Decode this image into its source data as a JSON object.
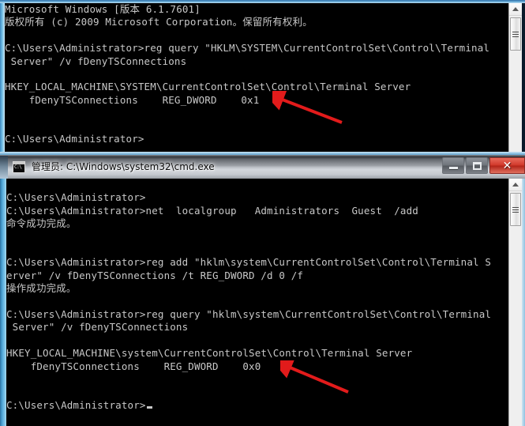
{
  "windows": {
    "top": {
      "name": "cmd-console-top",
      "lines": [
        "Microsoft Windows [版本 6.1.7601]",
        "版权所有 (c) 2009 Microsoft Corporation。保留所有权利。",
        "",
        "C:\\Users\\Administrator>reg query \"HKLM\\SYSTEM\\CurrentControlSet\\Control\\Terminal",
        " Server\" /v fDenyTSConnections",
        "",
        "HKEY_LOCAL_MACHINE\\SYSTEM\\CurrentControlSet\\Control\\Terminal Server",
        "    fDenyTSConnections    REG_DWORD    0x1",
        "",
        "",
        "C:\\Users\\Administrator>"
      ],
      "highlight_value": "0x1"
    },
    "bottom": {
      "name": "cmd-console-bottom",
      "titlebar": {
        "title": "管理员: C:\\Windows\\system32\\cmd.exe",
        "icon_label": "C:\\",
        "minimize_label": "最小化",
        "maximize_label": "最大化",
        "close_label": "✕"
      },
      "lines": [
        "",
        "C:\\Users\\Administrator>",
        "C:\\Users\\Administrator>net  localgroup   Administrators  Guest  /add",
        "命令成功完成。",
        "",
        "",
        "C:\\Users\\Administrator>reg add \"hklm\\system\\CurrentControlSet\\Control\\Terminal S",
        "erver\" /v fDenyTSConnections /t REG_DWORD /d 0 /f",
        "操作成功完成。",
        "",
        "C:\\Users\\Administrator>reg query \"hklm\\system\\CurrentControlSet\\Control\\Terminal",
        " Server\" /v fDenyTSConnections",
        "",
        "HKEY_LOCAL_MACHINE\\system\\CurrentControlSet\\Control\\Terminal Server",
        "    fDenyTSConnections    REG_DWORD    0x0",
        "",
        "",
        "C:\\Users\\Administrator>"
      ],
      "highlight_value": "0x0"
    }
  },
  "annotations": [
    {
      "name": "arrow-pointing-to-0x1",
      "color": "#e21b1b",
      "target": "0x1"
    },
    {
      "name": "arrow-pointing-to-0x0",
      "color": "#e21b1b",
      "target": "0x0"
    }
  ],
  "colors": {
    "console_bg": "#000000",
    "console_fg": "#c8c8c8",
    "arrow_red": "#e21b1b",
    "aero_blue": "#62b4e0",
    "close_red": "#d1392b"
  }
}
